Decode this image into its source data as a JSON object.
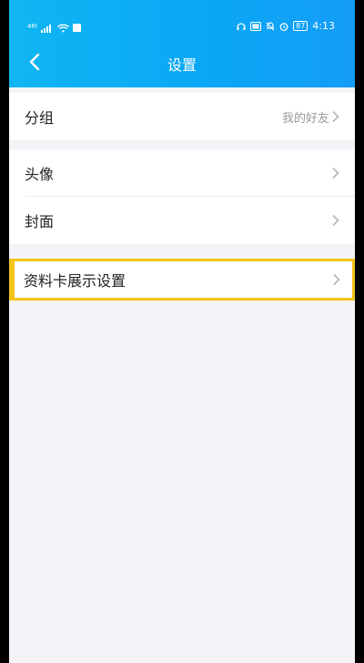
{
  "status_bar": {
    "left_text": "⁴⁶ᴵ",
    "battery": "87",
    "time": "4:13"
  },
  "nav": {
    "title": "设置"
  },
  "groups": [
    {
      "items": [
        {
          "label": "分组",
          "value": "我的好友"
        }
      ]
    },
    {
      "items": [
        {
          "label": "头像"
        },
        {
          "label": "封面"
        }
      ]
    },
    {
      "items": [
        {
          "label": "资料卡展示设置"
        }
      ]
    }
  ],
  "colors": {
    "header": "#10b6f2",
    "background": "#f4f4f8",
    "highlight": "#f6c41b"
  }
}
